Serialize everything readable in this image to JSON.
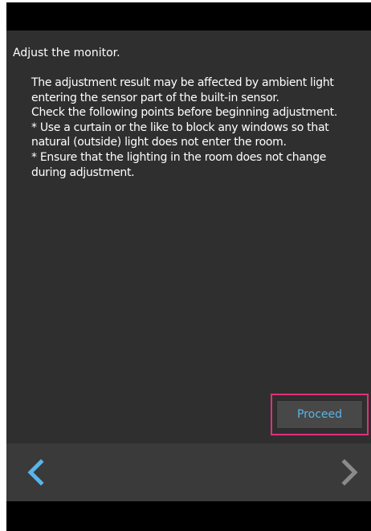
{
  "dialog": {
    "title": "Adjust the monitor.",
    "message_lines": [
      "The adjustment result may be affected by ambient light",
      "entering the sensor part of the built-in sensor.",
      "Check the following points before beginning adjustment.",
      "* Use a curtain or the like to block any windows so that",
      "natural (outside) light does not enter the room.",
      "* Ensure that the lighting in the room does not change",
      "during adjustment."
    ]
  },
  "actions": {
    "proceed_label": "Proceed"
  },
  "navigation": {
    "back_icon": "chevron-left-icon",
    "forward_icon": "chevron-right-icon",
    "back_enabled": true,
    "forward_enabled": false
  },
  "colors": {
    "content_background": "#2f2f2f",
    "nav_background": "#3a3a3a",
    "accent_blue": "#5ab4e8",
    "focus_highlight": "#e0307a",
    "disabled_gray": "#8a8a8a"
  }
}
